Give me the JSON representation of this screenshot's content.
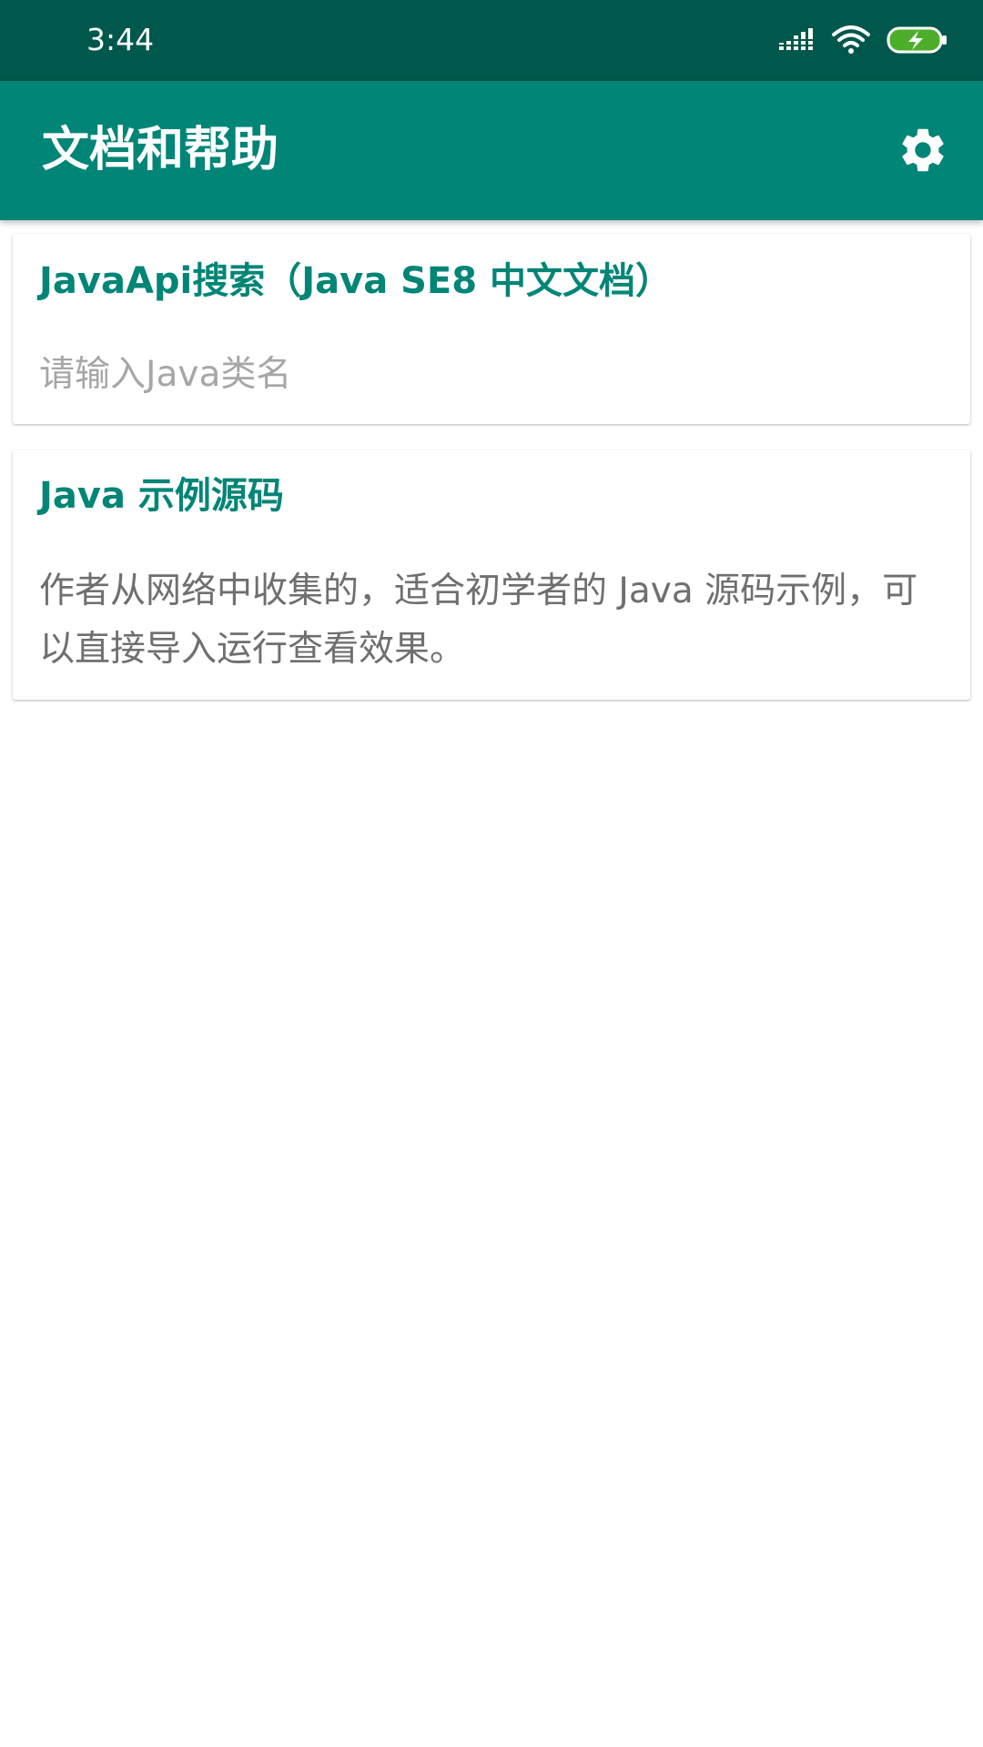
{
  "status_bar": {
    "time": "3:44",
    "icons": [
      "signal-icon",
      "wifi-icon",
      "battery-charging-icon"
    ],
    "color": "#00574b"
  },
  "app_bar": {
    "title": "文档和帮助",
    "action_icon": "gear-icon",
    "color": "#008577"
  },
  "cards": [
    {
      "title": "JavaApi搜索（Java SE8 中文文档）",
      "input_placeholder": "请输入Java类名",
      "input_value": ""
    },
    {
      "title": "Java 示例源码",
      "description": "作者从网络中收集的，适合初学者的 Java 源码示例，可以直接导入运行查看效果。"
    }
  ],
  "colors": {
    "accent": "#008577",
    "placeholder": "#a6a6a6",
    "body_text": "#6f6f6f",
    "battery_fill": "#4caf2a"
  }
}
